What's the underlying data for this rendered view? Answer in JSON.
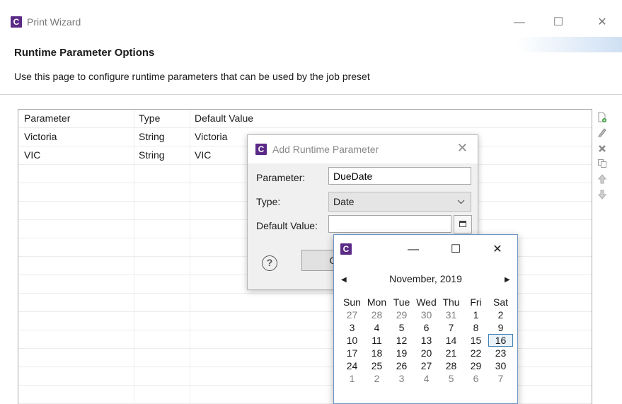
{
  "window": {
    "app_icon_glyph": "C",
    "title": "Print Wizard",
    "minimize_glyph": "—",
    "maximize_glyph": "☐",
    "close_glyph": "✕"
  },
  "page": {
    "heading": "Runtime Parameter Options",
    "description": "Use this page to configure runtime parameters that can be used by the job preset"
  },
  "table": {
    "columns": [
      "Parameter",
      "Type",
      "Default Value"
    ],
    "rows": [
      [
        "Victoria",
        "String",
        "Victoria"
      ],
      [
        "VIC",
        "String",
        "VIC"
      ]
    ]
  },
  "side_toolbar": [
    "add-icon",
    "edit-icon",
    "delete-icon",
    "copy-icon",
    "move-up-icon",
    "move-down-icon"
  ],
  "dialog": {
    "title": "Add Runtime Parameter",
    "close_glyph": "✕",
    "parameter_label": "Parameter:",
    "parameter_value": "DueDate",
    "type_label": "Type:",
    "type_value": "Date",
    "default_label": "Default Value:",
    "default_value": "",
    "help_glyph": "?",
    "ok_label": "O"
  },
  "calendar": {
    "app_icon_glyph": "C",
    "minimize_glyph": "—",
    "maximize_glyph": "☐",
    "close_glyph": "✕",
    "prev_glyph": "◀",
    "next_glyph": "▶",
    "month": "November, 2019",
    "weekdays": [
      "Sun",
      "Mon",
      "Tue",
      "Wed",
      "Thu",
      "Fri",
      "Sat"
    ],
    "weeks": [
      [
        "27",
        "28",
        "29",
        "30",
        "31",
        "1",
        "2"
      ],
      [
        "3",
        "4",
        "5",
        "6",
        "7",
        "8",
        "9"
      ],
      [
        "10",
        "11",
        "12",
        "13",
        "14",
        "15",
        "16"
      ],
      [
        "17",
        "18",
        "19",
        "20",
        "21",
        "22",
        "23"
      ],
      [
        "24",
        "25",
        "26",
        "27",
        "28",
        "29",
        "30"
      ],
      [
        "1",
        "2",
        "3",
        "4",
        "5",
        "6",
        "7"
      ]
    ],
    "selected_day": "16"
  },
  "colors": {
    "app_icon": "#5b2a86",
    "selection": "#3c7fb1"
  }
}
